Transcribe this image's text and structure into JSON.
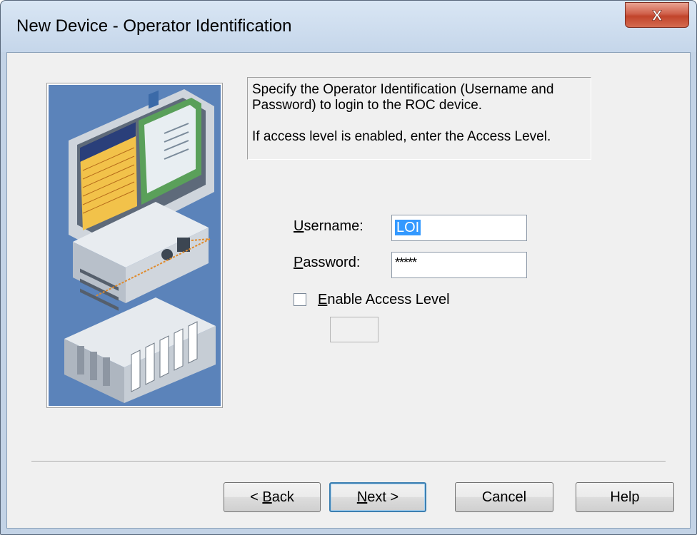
{
  "window": {
    "title": "New Device - Operator Identification",
    "close_glyph": "X"
  },
  "description": {
    "line1": "Specify the Operator Identification (Username and Password) to login to the ROC device.",
    "line2": "If access level is enabled, enter the Access Level."
  },
  "form": {
    "username": {
      "label_u": "U",
      "label_rest": "sername:",
      "value": "LOI"
    },
    "password": {
      "label_u": "P",
      "label_rest": "assword:",
      "value": "*****"
    },
    "access_level": {
      "label_u": "E",
      "label_rest": "nable Access Level",
      "checked": false,
      "value": ""
    }
  },
  "buttons": {
    "back": {
      "prefix": "< ",
      "u": "B",
      "rest": "ack"
    },
    "next": {
      "u": "N",
      "rest": "ext >"
    },
    "cancel": "Cancel",
    "help": "Help"
  },
  "colors": {
    "selection": "#3399ff",
    "illustration_bg": "#5b83ba",
    "close_button": "#c1442b"
  },
  "icons": [
    "close-icon",
    "computer-illustration",
    "plc-rack-illustration"
  ]
}
